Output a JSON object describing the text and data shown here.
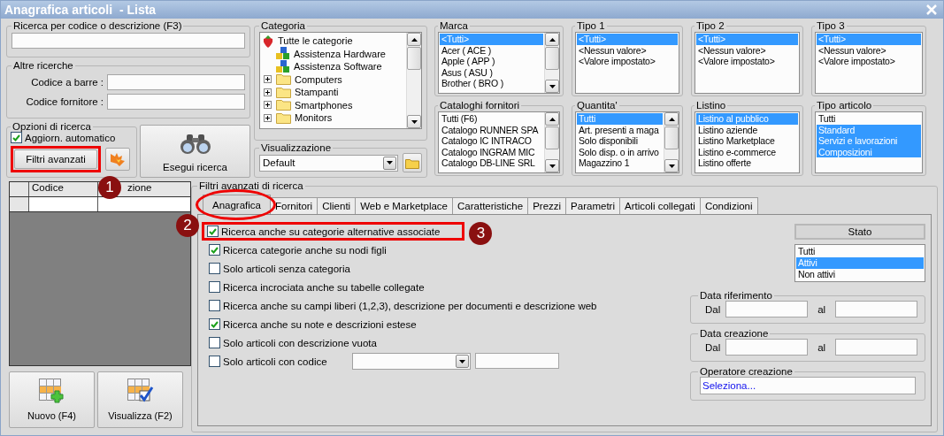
{
  "window": {
    "title": "Anagrafica articoli  - Lista"
  },
  "quick_search": {
    "label": "Ricerca per codice o descrizione (F3)"
  },
  "other_searches": {
    "label": "Altre ricerche",
    "fields": [
      {
        "label": "Codice a barre :"
      },
      {
        "label": "Codice fornitore :"
      }
    ]
  },
  "search_options": {
    "label": "Opzioni di ricerca",
    "auto_update": {
      "label": "Aggiorn. automatico",
      "checked": true
    },
    "advanced_button": {
      "label": "Filtri avanzati",
      "highlighted": true,
      "badge": "1"
    }
  },
  "search_button": {
    "label": "Esegui ricerca"
  },
  "category": {
    "label": "Categoria",
    "tree": [
      {
        "label": "Tutte le categorie",
        "kind": "root",
        "children": [
          {
            "label": "Assistenza Hardware",
            "kind": "blocks"
          },
          {
            "label": "Assistenza Software",
            "kind": "blocks"
          },
          {
            "label": "Computers",
            "kind": "folder",
            "expanded": false
          },
          {
            "label": "Stampanti",
            "kind": "folder",
            "expanded": false
          },
          {
            "label": "Smartphones",
            "kind": "folder",
            "expanded": false
          },
          {
            "label": "Monitors",
            "kind": "folder",
            "expanded": false
          }
        ]
      }
    ]
  },
  "view": {
    "label": "Visualizzazione",
    "value": "Default"
  },
  "lists": [
    {
      "label": "Marca",
      "scrollable": true,
      "items": [
        {
          "label": "<Tutti>",
          "selected": true
        },
        {
          "label": "Acer ( ACE )",
          "selected": false
        },
        {
          "label": "Apple ( APP )",
          "selected": false
        },
        {
          "label": "Asus ( ASU )",
          "selected": false
        },
        {
          "label": "Brother ( BRO )",
          "selected": false
        }
      ]
    },
    {
      "label": "Tipo 1",
      "scrollable": false,
      "items": [
        {
          "label": "<Tutti>",
          "selected": true
        },
        {
          "label": "<Nessun valore>",
          "selected": false
        },
        {
          "label": "<Valore impostato>",
          "selected": false
        }
      ]
    },
    {
      "label": "Tipo 2",
      "scrollable": false,
      "items": [
        {
          "label": "<Tutti>",
          "selected": true
        },
        {
          "label": "<Nessun valore>",
          "selected": false
        },
        {
          "label": "<Valore impostato>",
          "selected": false
        }
      ]
    },
    {
      "label": "Tipo 3",
      "scrollable": false,
      "items": [
        {
          "label": "<Tutti>",
          "selected": true
        },
        {
          "label": "<Nessun valore>",
          "selected": false
        },
        {
          "label": "<Valore impostato>",
          "selected": false
        }
      ]
    },
    {
      "label": "Cataloghi fornitori",
      "scrollable": true,
      "items": [
        {
          "label": "Tutti (F6)",
          "selected": false
        },
        {
          "label": "Catalogo RUNNER SPA",
          "selected": false
        },
        {
          "label": "Catalogo IC INTRACO",
          "selected": false
        },
        {
          "label": "Catalogo INGRAM MIC",
          "selected": false
        },
        {
          "label": "Catalogo DB-LINE SRL",
          "selected": false
        }
      ]
    },
    {
      "label": "Quantita'",
      "scrollable": true,
      "items": [
        {
          "label": "Tutti",
          "selected": true
        },
        {
          "label": "Art. presenti a maga",
          "selected": false
        },
        {
          "label": "Solo disponibili",
          "selected": false
        },
        {
          "label": "Solo disp. o in arrivo",
          "selected": false
        },
        {
          "label": "Magazzino 1",
          "selected": false
        }
      ]
    },
    {
      "label": "Listino",
      "scrollable": false,
      "items": [
        {
          "label": "Listino al pubblico",
          "selected": true
        },
        {
          "label": "Listino aziende",
          "selected": false
        },
        {
          "label": "Listino Marketplace",
          "selected": false
        },
        {
          "label": "Listino e-commerce",
          "selected": false
        },
        {
          "label": "Listino offerte",
          "selected": false
        }
      ]
    },
    {
      "label": "Tipo articolo",
      "scrollable": false,
      "items": [
        {
          "label": "Tutti",
          "selected": false
        },
        {
          "label": "Standard",
          "selected": true
        },
        {
          "label": "Servizi e lavorazioni",
          "selected": true
        },
        {
          "label": "Composizioni",
          "selected": true
        }
      ]
    }
  ],
  "grid": {
    "columns": [
      {
        "label": "Codice"
      },
      {
        "label": "zione"
      }
    ]
  },
  "buttons": [
    {
      "label": "Nuovo (F4)",
      "kind": "new"
    },
    {
      "label": "Visualizza (F2)",
      "kind": "view"
    }
  ],
  "advanced_filters": {
    "label": "Filtri avanzati di ricerca",
    "tabs": [
      {
        "label": "Anagrafica",
        "selected": true,
        "circled": true,
        "badge": "2"
      },
      {
        "label": "Fornitori",
        "selected": false
      },
      {
        "label": "Clienti",
        "selected": false
      },
      {
        "label": "Web e Marketplace",
        "selected": false
      },
      {
        "label": "Caratteristiche",
        "selected": false
      },
      {
        "label": "Prezzi",
        "selected": false
      },
      {
        "label": "Parametri",
        "selected": false
      },
      {
        "label": "Articoli collegati",
        "selected": false
      },
      {
        "label": "Condizioni",
        "selected": false
      }
    ],
    "options": [
      {
        "label": "Ricerca anche su categorie alternative associate",
        "checked": true,
        "kind": "plain",
        "highlighted": true,
        "badge": "3"
      },
      {
        "label": "Ricerca categorie anche su nodi figli",
        "checked": true,
        "kind": "plain"
      },
      {
        "label": "Solo articoli senza categoria",
        "checked": false,
        "kind": "plain"
      },
      {
        "label": "Ricerca incrociata anche su tabelle collegate",
        "checked": false,
        "kind": "plain"
      },
      {
        "label": "Ricerca anche su campi liberi (1,2,3), descrizione per documenti e descrizione web",
        "checked": false,
        "kind": "plain"
      },
      {
        "label": "Ricerca anche su note e descrizioni estese",
        "checked": true,
        "kind": "plain"
      },
      {
        "label": "Solo articoli con descrizione vuota",
        "checked": false,
        "kind": "plain"
      },
      {
        "label": "Solo articoli con codice",
        "checked": false,
        "kind": "with_fields"
      }
    ],
    "status": {
      "header": "Stato",
      "items": [
        {
          "label": "Tutti",
          "selected": false
        },
        {
          "label": "Attivi",
          "selected": true
        },
        {
          "label": "Non attivi",
          "selected": false
        }
      ]
    },
    "date_ranges": [
      {
        "label": "Data riferimento",
        "from_label": "Dal",
        "to_label": "al"
      },
      {
        "label": "Data creazione",
        "from_label": "Dal",
        "to_label": "al"
      }
    ],
    "creator": {
      "label": "Operatore creazione",
      "value": "Seleziona..."
    }
  }
}
